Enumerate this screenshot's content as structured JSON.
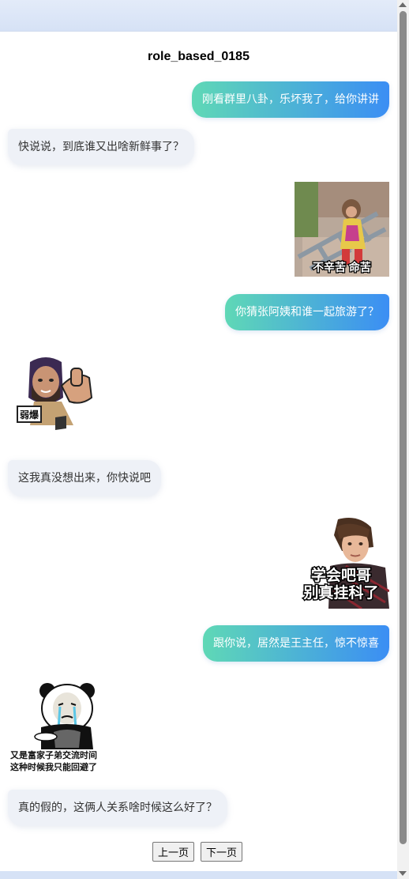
{
  "title": "role_based_0185",
  "messages": [
    {
      "side": "right",
      "text": "刚看群里八卦，乐坏我了，给你讲讲"
    },
    {
      "side": "left",
      "text": "快说说，到底谁又出啥新鲜事了？"
    },
    {
      "side": "right",
      "sticker": "monkey-sticker",
      "caption": "不辛苦 命苦"
    },
    {
      "side": "right",
      "text": "你猜张阿姨和谁一起旅游了？"
    },
    {
      "side": "left",
      "sticker": "bearded-man-thumbs-down-sticker",
      "caption": "弱爆"
    },
    {
      "side": "left",
      "text": "这我真没想出来，你快说吧"
    },
    {
      "side": "right",
      "sticker": "boy-sticker",
      "caption_line1": "学会吧哥",
      "caption_line2": "别真挂科了"
    },
    {
      "side": "right",
      "text": "跟你说，居然是王主任，惊不惊喜"
    },
    {
      "side": "left",
      "sticker": "panda-crying-sticker",
      "caption_line1": "又是富家子弟交流时间",
      "caption_line2": "这种时候我只能回避了"
    },
    {
      "side": "left",
      "text": "真的假的，这俩人关系啥时候这么好了？"
    }
  ],
  "pagination": {
    "prev_label": "上一页",
    "next_label": "下一页"
  }
}
